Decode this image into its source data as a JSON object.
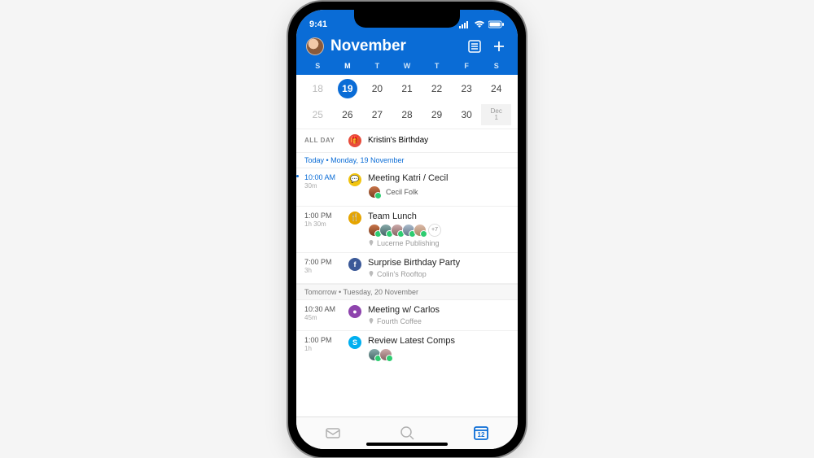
{
  "status": {
    "time": "9:41"
  },
  "header": {
    "title": "November"
  },
  "weekdays": [
    "S",
    "M",
    "T",
    "W",
    "T",
    "F",
    "S"
  ],
  "cal": {
    "rows": [
      [
        {
          "n": "18",
          "faded": true
        },
        {
          "n": "19",
          "selected": true
        },
        {
          "n": "20"
        },
        {
          "n": "21"
        },
        {
          "n": "22"
        },
        {
          "n": "23"
        },
        {
          "n": "24"
        }
      ],
      [
        {
          "n": "25",
          "faded": true
        },
        {
          "n": "26"
        },
        {
          "n": "27"
        },
        {
          "n": "28"
        },
        {
          "n": "29"
        },
        {
          "n": "30"
        },
        {
          "month": "Dec",
          "n": "1",
          "next": true
        }
      ]
    ]
  },
  "allday": {
    "label": "ALL DAY",
    "title": "Kristin's Birthday",
    "icon": "gift",
    "color": "bg-red"
  },
  "sections": [
    {
      "label": "Today • Monday, 19 November",
      "today": true,
      "events": [
        {
          "time": "10:00 AM",
          "dur": "30m",
          "icon": "bg-yellow",
          "glyph": "💬",
          "title": "Meeting Katri / Cecil",
          "people": [
            "p1"
          ],
          "personName": "Cecil Folk",
          "current": true
        },
        {
          "time": "1:00 PM",
          "dur": "1h 30m",
          "icon": "bg-gold",
          "glyph": "🍴",
          "title": "Team Lunch",
          "people": [
            "p1",
            "p2",
            "p3",
            "p4",
            "p5"
          ],
          "more": "+7",
          "loc": "Lucerne Publishing"
        },
        {
          "time": "7:00 PM",
          "dur": "3h",
          "icon": "bg-fb",
          "glyph": "f",
          "title": "Surprise Birthday Party",
          "loc": "Colin's Rooftop"
        }
      ]
    },
    {
      "label": "Tomorrow • Tuesday, 20 November",
      "events": [
        {
          "time": "10:30 AM",
          "dur": "45m",
          "icon": "bg-purple",
          "glyph": "●",
          "title": "Meeting w/ Carlos",
          "loc": "Fourth Coffee"
        },
        {
          "time": "1:00 PM",
          "dur": "1h",
          "icon": "bg-skype",
          "glyph": "S",
          "title": "Review Latest Comps",
          "people": [
            "p2",
            "p3"
          ]
        }
      ]
    }
  ],
  "tabs": {
    "calendarDate": "12"
  }
}
